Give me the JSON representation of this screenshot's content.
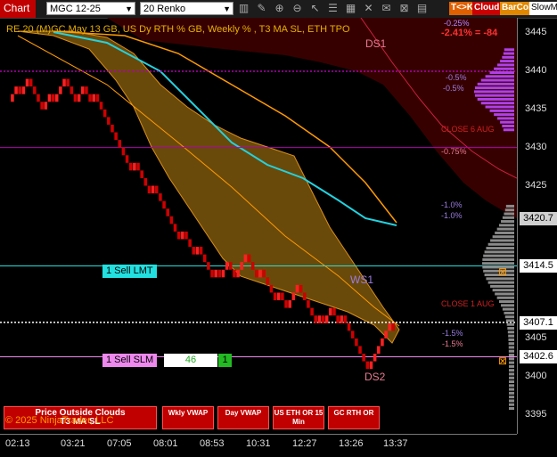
{
  "toolbar": {
    "chart_tab": "Chart",
    "instrument": "MGC 12-25",
    "bar_type": "20 Renko",
    "tko_button": "T<>K",
    "cloud_button": "Cloud",
    "barcol_button": "BarCol",
    "slowma_button": "SlowMa",
    "icons": [
      "bars-icon",
      "pencil-icon",
      "zoom-in-icon",
      "zoom-out-icon",
      "arrow-icon",
      "list-icon",
      "grid-icon",
      "cross-icon",
      "mail-icon",
      "lock-icon",
      "tile-icon"
    ]
  },
  "header": {
    "title": "RE 20  (M)GC May 13 GB, US Dy RTH % GB, Weekly % , T3 MA SL, ETH TPO",
    "pct_top": "-0.25%",
    "pct_change": "-2.41% = -84"
  },
  "chart_data": {
    "type": "renko",
    "brick_size": 1.0,
    "colors": {
      "up": "#ff2020",
      "down": "#d00000",
      "cloud_fill": "#6a4a0a",
      "cloud_edge": "#d98f1a",
      "cyan_ma": "#22d3e0",
      "orange_ma": "#ff9a00",
      "upper_cloud": "#3a0000",
      "profile_purple": "#b040e8",
      "profile_grey": "#8a8a8a",
      "line_magenta": "#b000b0"
    },
    "y_axis": {
      "ticks": [
        3445,
        3440,
        3435,
        3430,
        3425,
        3405,
        3400,
        3395
      ],
      "range": [
        3392.5,
        3447
      ]
    },
    "x_axis": {
      "ticks": [
        "02:13",
        "03:21",
        "07:05",
        "08:01",
        "08:53",
        "10:31",
        "12:27",
        "13:26",
        "13:37"
      ]
    },
    "price_badges": [
      {
        "value": 3420.7,
        "label": "3420.7",
        "bg": "#d0d0d0",
        "fg": "#000"
      },
      {
        "value": 3414.5,
        "label": "3414.5",
        "bg": "#ffffff",
        "fg": "#000"
      },
      {
        "value": 3407.1,
        "label": "3407.1",
        "bg": "#ffffff",
        "fg": "#000"
      },
      {
        "value": 3402.6,
        "label": "3402.6",
        "bg": "#ffffff",
        "fg": "#000"
      }
    ],
    "closes": [
      3436,
      3437,
      3438,
      3437,
      3438,
      3439,
      3438,
      3437,
      3436,
      3435,
      3436,
      3437,
      3436,
      3437,
      3438,
      3439,
      3438,
      3437,
      3436,
      3437,
      3438,
      3437,
      3436,
      3437,
      3436,
      3435,
      3434,
      3433,
      3432,
      3431,
      3430,
      3429,
      3428,
      3427,
      3428,
      3427,
      3426,
      3425,
      3424,
      3425,
      3424,
      3423,
      3422,
      3421,
      3420,
      3419,
      3418,
      3419,
      3418,
      3417,
      3416,
      3417,
      3416,
      3415,
      3414,
      3413,
      3414,
      3413,
      3414,
      3415,
      3414,
      3413,
      3414,
      3415,
      3416,
      3415,
      3414,
      3413,
      3414,
      3413,
      3412,
      3411,
      3410,
      3411,
      3410,
      3409,
      3410,
      3411,
      3412,
      3411,
      3410,
      3409,
      3408,
      3407,
      3408,
      3407,
      3408,
      3409,
      3408,
      3407,
      3408,
      3407,
      3406,
      3405,
      3404,
      3403,
      3402,
      3401,
      3402,
      3403,
      3404,
      3405,
      3406,
      3407,
      3406
    ],
    "levels": [
      {
        "price": 3440.0,
        "label": "-0.5%",
        "color": "#b000b0",
        "style": "dotted"
      },
      {
        "price": 3430.0,
        "label": "-0.75%",
        "color": "#b000b0",
        "style": "solid"
      },
      {
        "price": 3414.5,
        "label": "1 Sell LMT",
        "color": "#22e0e0",
        "style": "solid"
      },
      {
        "price": 3407.1,
        "label": "",
        "color": "#ffffff",
        "style": "dotted"
      },
      {
        "price": 3402.6,
        "label": "1 Sell SLM",
        "color": "#ee88ee",
        "style": "solid"
      }
    ],
    "annotations": [
      {
        "text": "DS1",
        "color": "#e87a90"
      },
      {
        "text": "-0.5%",
        "color": "#9a7ce0"
      },
      {
        "text": "-0.5%",
        "color": "#9a7ce0"
      },
      {
        "text": "CLOSE 6 AUG",
        "color": "#d02020"
      },
      {
        "text": "-0.75%",
        "color": "#e87a90"
      },
      {
        "text": "-1.0%",
        "color": "#9a7ce0"
      },
      {
        "text": "-1.0%",
        "color": "#9a7ce0"
      },
      {
        "text": "WS1",
        "color": "#9a7ce0"
      },
      {
        "text": "CLOSE 1 AUG",
        "color": "#d02020"
      },
      {
        "text": "-1.5%",
        "color": "#9a7ce0"
      },
      {
        "text": "-1.5%",
        "color": "#e87a90"
      },
      {
        "text": "DS2",
        "color": "#e87a90"
      }
    ]
  },
  "orders": {
    "sell_lmt": "1 Sell LMT",
    "sell_slm": "1 Sell SLM",
    "qty": "46",
    "qty_btn": "1"
  },
  "buttons": {
    "price_outside": "Price Outside Clouds",
    "ma_sl": "T3 MA SL",
    "wkly_vwap": "Wkly VWAP",
    "day_vwap": "Day VWAP",
    "us_eth": "US ETH OR 15 Min",
    "gc_rth": "GC RTH OR"
  },
  "footer": {
    "copyright": "© 2025 NinjaTrader, LLC"
  }
}
